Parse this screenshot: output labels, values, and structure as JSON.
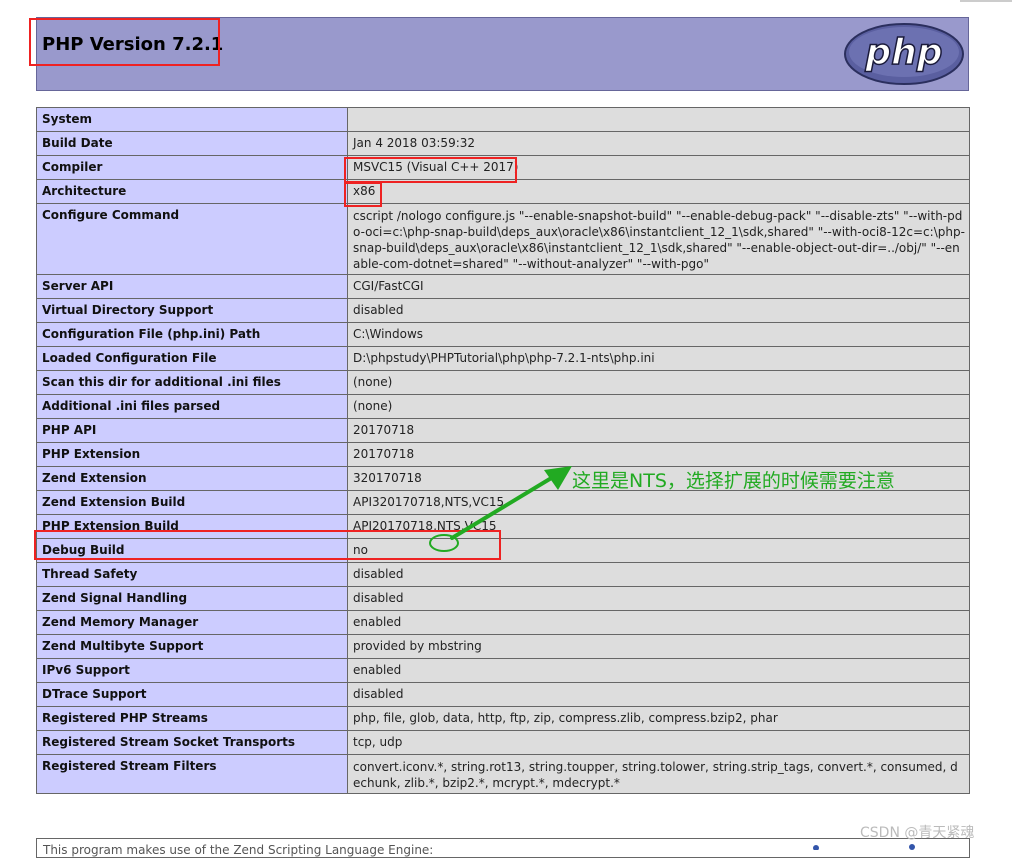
{
  "page": {
    "title": "PHP Version 7.2.1",
    "logo_text": "php",
    "colors": {
      "header_bg": "#9999cc",
      "label_bg": "#ccccff",
      "value_bg": "#dddddd",
      "highlight_red": "#ee2222",
      "annotation_green": "#22aa22"
    }
  },
  "rows": [
    {
      "label": "System",
      "value": ""
    },
    {
      "label": "Build Date",
      "value": "Jan 4 2018 03:59:32"
    },
    {
      "label": "Compiler",
      "value": "MSVC15 (Visual C++ 2017)"
    },
    {
      "label": "Architecture",
      "value": "x86"
    },
    {
      "label": "Configure Command",
      "value": "cscript /nologo configure.js \"--enable-snapshot-build\" \"--enable-debug-pack\" \"--disable-zts\" \"--with-pdo-oci=c:\\php-snap-build\\deps_aux\\oracle\\x86\\instantclient_12_1\\sdk,shared\" \"--with-oci8-12c=c:\\php-snap-build\\deps_aux\\oracle\\x86\\instantclient_12_1\\sdk,shared\" \"--enable-object-out-dir=../obj/\" \"--enable-com-dotnet=shared\" \"--without-analyzer\" \"--with-pgo\""
    },
    {
      "label": "Server API",
      "value": "CGI/FastCGI"
    },
    {
      "label": "Virtual Directory Support",
      "value": "disabled"
    },
    {
      "label": "Configuration File (php.ini) Path",
      "value": "C:\\Windows"
    },
    {
      "label": "Loaded Configuration File",
      "value": "D:\\phpstudy\\PHPTutorial\\php\\php-7.2.1-nts\\php.ini"
    },
    {
      "label": "Scan this dir for additional .ini files",
      "value": "(none)"
    },
    {
      "label": "Additional .ini files parsed",
      "value": "(none)"
    },
    {
      "label": "PHP API",
      "value": "20170718"
    },
    {
      "label": "PHP Extension",
      "value": "20170718"
    },
    {
      "label": "Zend Extension",
      "value": "320170718"
    },
    {
      "label": "Zend Extension Build",
      "value": "API320170718,NTS,VC15"
    },
    {
      "label": "PHP Extension Build",
      "value": "API20170718,NTS,VC15"
    },
    {
      "label": "Debug Build",
      "value": "no"
    },
    {
      "label": "Thread Safety",
      "value": "disabled"
    },
    {
      "label": "Zend Signal Handling",
      "value": "disabled"
    },
    {
      "label": "Zend Memory Manager",
      "value": "enabled"
    },
    {
      "label": "Zend Multibyte Support",
      "value": "provided by mbstring"
    },
    {
      "label": "IPv6 Support",
      "value": "enabled"
    },
    {
      "label": "DTrace Support",
      "value": "disabled"
    },
    {
      "label": "Registered PHP Streams",
      "value": "php, file, glob, data, http, ftp, zip, compress.zlib, compress.bzip2, phar"
    },
    {
      "label": "Registered Stream Socket Transports",
      "value": "tcp, udp"
    },
    {
      "label": "Registered Stream Filters",
      "value": "convert.iconv.*, string.rot13, string.toupper, string.tolower, string.strip_tags, convert.*, consumed, dechunk, zlib.*, bzip2.*, mcrypt.*, mdecrypt.*"
    }
  ],
  "footer": {
    "text": "This program makes use of the Zend Scripting Language Engine:"
  },
  "annotation": {
    "text": "这里是NTS，选择扩展的时候需要注意"
  },
  "watermark": {
    "text": "CSDN @青天紧魂"
  }
}
